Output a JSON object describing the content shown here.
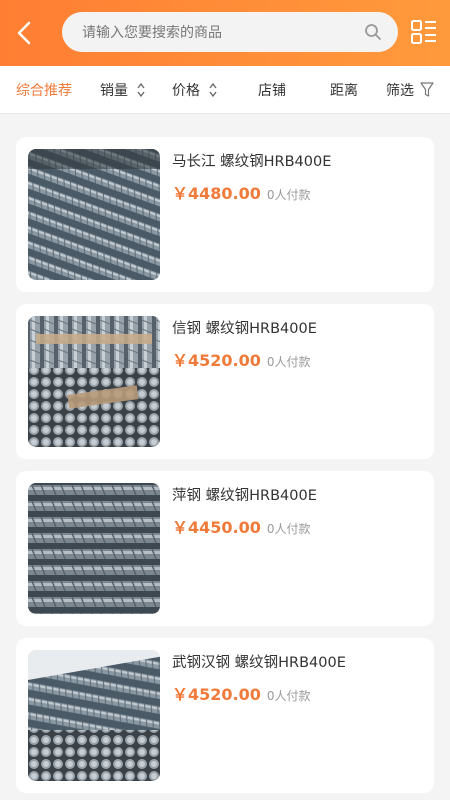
{
  "header": {
    "back_icon": "chevron-left-icon",
    "search_placeholder": "请输入您要搜索的商品",
    "search_icon": "search-icon",
    "menu_icon": "grid-list-icon",
    "brand_color": "#ff8a35"
  },
  "filters": [
    {
      "label": "综合推荐",
      "active": true
    },
    {
      "label": "销量",
      "sortable": true
    },
    {
      "label": "价格",
      "sortable": true
    },
    {
      "label": "店铺"
    },
    {
      "label": "距离"
    },
    {
      "label": "筛选",
      "icon": "funnel-icon"
    }
  ],
  "products": [
    {
      "title": "马长江 螺纹钢HRB400E",
      "price": "￥4480.00",
      "sales": "0人付款"
    },
    {
      "title": "信钢 螺纹钢HRB400E",
      "price": "￥4520.00",
      "sales": "0人付款"
    },
    {
      "title": "萍钢 螺纹钢HRB400E",
      "price": "￥4450.00",
      "sales": "0人付款"
    },
    {
      "title": "武钢汉钢 螺纹钢HRB400E",
      "price": "￥4520.00",
      "sales": "0人付款"
    }
  ],
  "accent_color": "#f07a3a"
}
